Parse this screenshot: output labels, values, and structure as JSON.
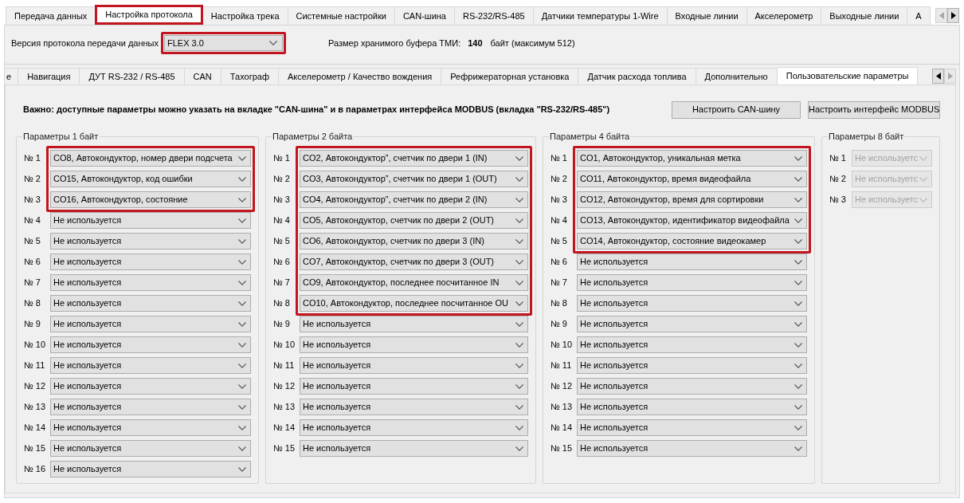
{
  "tabs": [
    {
      "label": "Передача данных",
      "selected": false,
      "highlighted": false
    },
    {
      "label": "Настройка протокола",
      "selected": true,
      "highlighted": true
    },
    {
      "label": "Настройка трека",
      "selected": false,
      "highlighted": false
    },
    {
      "label": "Системные настройки",
      "selected": false,
      "highlighted": false
    },
    {
      "label": "CAN-шина",
      "selected": false,
      "highlighted": false
    },
    {
      "label": "RS-232/RS-485",
      "selected": false,
      "highlighted": false
    },
    {
      "label": "Датчики температуры 1-Wire",
      "selected": false,
      "highlighted": false
    },
    {
      "label": "Входные линии",
      "selected": false,
      "highlighted": false
    },
    {
      "label": "Акселерометр",
      "selected": false,
      "highlighted": false
    },
    {
      "label": "Выходные линии",
      "selected": false,
      "highlighted": false
    },
    {
      "label": "А",
      "selected": false,
      "highlighted": false
    }
  ],
  "tab_scroll": {
    "left_disabled": true,
    "right_disabled": false
  },
  "protocol": {
    "label": "Версия протокола передачи данных",
    "value": "FLEX 3.0",
    "highlighted": true
  },
  "buffer": {
    "label": "Размер хранимого буфера ТМИ:",
    "value": "140",
    "unit": "байт (максимум 512)"
  },
  "subtabs": [
    {
      "label": "е",
      "selected": false
    },
    {
      "label": "Навигация",
      "selected": false
    },
    {
      "label": "ДУТ RS-232 / RS-485",
      "selected": false
    },
    {
      "label": "CAN",
      "selected": false
    },
    {
      "label": "Тахограф",
      "selected": false
    },
    {
      "label": "Акселерометр / Качество вождения",
      "selected": false
    },
    {
      "label": "Рефрижераторная установка",
      "selected": false
    },
    {
      "label": "Датчик расхода топлива",
      "selected": false
    },
    {
      "label": "Дополнительно",
      "selected": false
    },
    {
      "label": "Пользовательские параметры",
      "selected": true
    }
  ],
  "subtab_scroll": {
    "left_disabled": false,
    "right_disabled": true
  },
  "notice": "Важно: доступные параметры можно указать на вкладке \"CAN-шина\" и в параметрах интерфейса MODBUS (вкладка \"RS-232/RS-485\")",
  "buttons": [
    "Настроить CAN-шину",
    "Настроить интерфейс MODBUS"
  ],
  "groups": [
    {
      "title": "Параметры 1 байт",
      "disabled": false,
      "highlighted_rows": [
        {
          "label": "№ 1",
          "value": "CO8, Автокондуктор, номер двери подсчета"
        },
        {
          "label": "№ 2",
          "value": "CO15, Автокондуктор, код ошибки"
        },
        {
          "label": "№ 3",
          "value": "CO16, Автокондуктор, состояние"
        }
      ],
      "rows": [
        {
          "label": "№ 4",
          "value": "Не используется"
        },
        {
          "label": "№ 5",
          "value": "Не используется"
        },
        {
          "label": "№ 6",
          "value": "Не используется"
        },
        {
          "label": "№ 7",
          "value": "Не используется"
        },
        {
          "label": "№ 8",
          "value": "Не используется"
        },
        {
          "label": "№ 9",
          "value": "Не используется"
        },
        {
          "label": "№ 10",
          "value": "Не используется"
        },
        {
          "label": "№ 11",
          "value": "Не используется"
        },
        {
          "label": "№ 12",
          "value": "Не используется"
        },
        {
          "label": "№ 13",
          "value": "Не используется"
        },
        {
          "label": "№ 14",
          "value": "Не используется"
        },
        {
          "label": "№ 15",
          "value": "Не используется"
        },
        {
          "label": "№ 16",
          "value": "Не используется"
        }
      ]
    },
    {
      "title": "Параметры 2 байта",
      "disabled": false,
      "highlighted_rows": [
        {
          "label": "№ 1",
          "value": "CO2, Автокондуктор”, счетчик по двери 1 (IN)"
        },
        {
          "label": "№ 2",
          "value": "CO3, Автокондуктор”, счетчик по двери 1 (OUT)"
        },
        {
          "label": "№ 3",
          "value": "CO4, Автокондуктор”, счетчик по двери 2 (IN)"
        },
        {
          "label": "№ 4",
          "value": "CO5, Автокондуктор, счетчик по двери 2 (OUT)"
        },
        {
          "label": "№ 5",
          "value": "CO6, Автокондуктор, счетчик по двери 3 (IN)"
        },
        {
          "label": "№ 6",
          "value": "CO7, Автокондуктор, счетчик по двери 3 (OUT)"
        },
        {
          "label": "№ 7",
          "value": "CO9, Автокондуктор, последнее посчитанное IN"
        },
        {
          "label": "№ 8",
          "value": "CO10, Автокондуктор, последнее посчитанное OU"
        }
      ],
      "rows": [
        {
          "label": "№ 9",
          "value": "Не используется"
        },
        {
          "label": "№ 10",
          "value": "Не используется"
        },
        {
          "label": "№ 11",
          "value": "Не используется"
        },
        {
          "label": "№ 12",
          "value": "Не используется"
        },
        {
          "label": "№ 13",
          "value": "Не используется"
        },
        {
          "label": "№ 14",
          "value": "Не используется"
        },
        {
          "label": "№ 15",
          "value": "Не используется"
        }
      ]
    },
    {
      "title": "Параметры 4 байта",
      "disabled": false,
      "highlighted_rows": [
        {
          "label": "№ 1",
          "value": "CO1, Автокондуктор, уникальная метка"
        },
        {
          "label": "№ 2",
          "value": "CO11, Автокондуктор, время видеофайла"
        },
        {
          "label": "№ 3",
          "value": "CO12, Автокондуктор, время для сортировки"
        },
        {
          "label": "№ 4",
          "value": "CO13, Автокондуктор, идентификатор видеофайла"
        },
        {
          "label": "№ 5",
          "value": "CO14, Автокондуктор, состояние видеокамер"
        }
      ],
      "rows": [
        {
          "label": "№ 6",
          "value": "Не используется"
        },
        {
          "label": "№ 7",
          "value": "Не используется"
        },
        {
          "label": "№ 8",
          "value": "Не используется"
        },
        {
          "label": "№ 9",
          "value": "Не используется"
        },
        {
          "label": "№ 10",
          "value": "Не используется"
        },
        {
          "label": "№ 11",
          "value": "Не используется"
        },
        {
          "label": "№ 12",
          "value": "Не используется"
        },
        {
          "label": "№ 13",
          "value": "Не используется"
        },
        {
          "label": "№ 14",
          "value": "Не используется"
        },
        {
          "label": "№ 15",
          "value": "Не используется"
        }
      ]
    },
    {
      "title": "Параметры 8 байт",
      "disabled": true,
      "rows": [
        {
          "label": "№ 1",
          "value": "Не используетс"
        },
        {
          "label": "№ 2",
          "value": "Не используетс"
        },
        {
          "label": "№ 3",
          "value": "Не используетс"
        }
      ]
    }
  ]
}
